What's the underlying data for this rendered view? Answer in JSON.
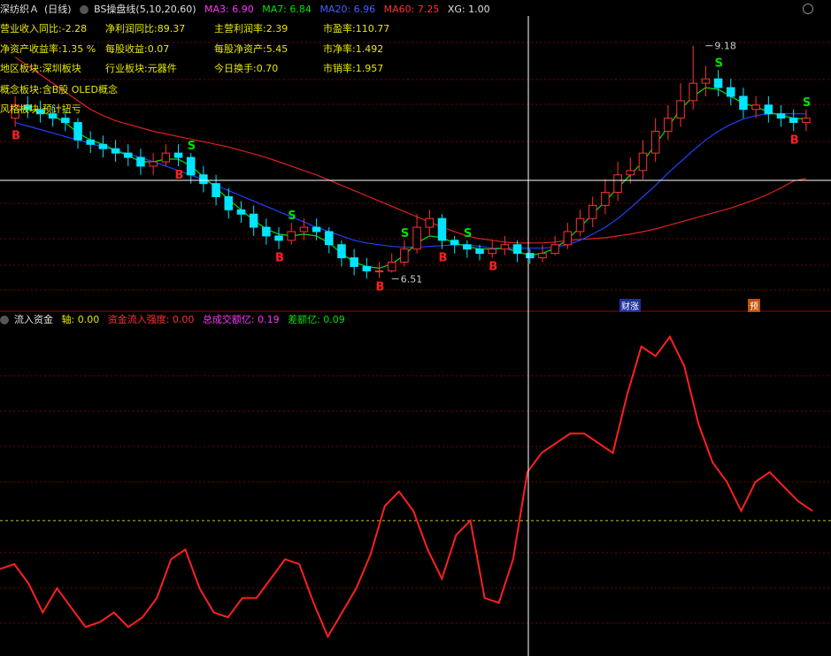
{
  "header": {
    "stock": "深纺织Ａ",
    "period": "(日线)",
    "indicator": "BS操盘线(5,10,20,60)",
    "ma3": "MA3: 6.90",
    "ma7": "MA7: 6.84",
    "ma20": "MA20: 6.96",
    "ma60": "MA60: 7.25",
    "xg": "XG: 1.00"
  },
  "info": {
    "r1": [
      {
        "label": "营业收入同比:",
        "value": "-2.28"
      },
      {
        "label": "净利润同比:",
        "value": "89.37"
      },
      {
        "label": "主营利润率:",
        "value": "2.39"
      },
      {
        "label": "市盈率:",
        "value": "110.77"
      }
    ],
    "r2": [
      {
        "label": "净资产收益率:",
        "value": "1.35 %"
      },
      {
        "label": "每股收益:",
        "value": "0.07"
      },
      {
        "label": "每股净资产:",
        "value": "5.45"
      },
      {
        "label": "市净率:",
        "value": "1.492"
      }
    ],
    "r3": [
      {
        "label": "地区板块:",
        "value": "深圳板块"
      },
      {
        "label": "行业板块:",
        "value": "元器件"
      },
      {
        "label": "今日换手:",
        "value": "0.70"
      },
      {
        "label": "市销率:",
        "value": "1.957"
      }
    ],
    "r4": {
      "label": "概念板块:",
      "value": "含B股 OLED概念"
    },
    "r5": {
      "label": "风格板块:",
      "value": "预计扭亏"
    }
  },
  "tags": {
    "left": "财涨",
    "right": "预"
  },
  "sub_header": {
    "name": "流入资金",
    "axis": "轴: 0.00",
    "strength": "资金流入强度: 0.00",
    "total": "总成交额亿: 0.19",
    "diff": "差额亿: 0.09"
  },
  "colors": {
    "up": "#ff3333",
    "down": "#00e5ff",
    "ma5": "#00e000",
    "ma20": "#2040ff",
    "ma60": "#e02020",
    "grid": "#7a0000",
    "crosshair": "#ffffff",
    "flow": "#ff2020",
    "zero": "#c8c800"
  },
  "chart_data": [
    {
      "type": "candlestick",
      "title": "",
      "ylim": [
        6.3,
        9.4
      ],
      "annotations": [
        {
          "text": "9.18",
          "x": 56,
          "y": 9.18
        },
        {
          "text": "6.51",
          "x": 31,
          "y": 6.51
        }
      ],
      "x": [
        1,
        2,
        3,
        4,
        5,
        6,
        7,
        8,
        9,
        10,
        11,
        12,
        13,
        14,
        15,
        16,
        17,
        18,
        19,
        20,
        21,
        22,
        23,
        24,
        25,
        26,
        27,
        28,
        29,
        30,
        31,
        32,
        33,
        34,
        35,
        36,
        37,
        38,
        39,
        40,
        41,
        42,
        43,
        44,
        45,
        46,
        47,
        48,
        49,
        50,
        51,
        52,
        53,
        54,
        55,
        56,
        57,
        58,
        59,
        60,
        61,
        62,
        63,
        64
      ],
      "open": [
        8.35,
        8.5,
        8.45,
        8.4,
        8.35,
        8.3,
        8.1,
        8.05,
        8.0,
        7.95,
        7.9,
        7.8,
        7.85,
        7.95,
        7.9,
        7.7,
        7.6,
        7.45,
        7.3,
        7.25,
        7.1,
        7.0,
        6.95,
        7.05,
        7.1,
        7.05,
        6.9,
        6.75,
        6.65,
        6.6,
        6.6,
        6.7,
        6.85,
        7.1,
        7.2,
        6.95,
        6.9,
        6.85,
        6.8,
        6.85,
        6.9,
        6.8,
        6.75,
        6.8,
        6.9,
        7.05,
        7.2,
        7.35,
        7.5,
        7.7,
        7.75,
        7.95,
        8.2,
        8.35,
        8.55,
        8.75,
        8.8,
        8.7,
        8.6,
        8.45,
        8.5,
        8.4,
        8.35,
        8.3
      ],
      "close": [
        8.5,
        8.45,
        8.4,
        8.35,
        8.3,
        8.1,
        8.05,
        8.0,
        7.95,
        7.9,
        7.8,
        7.85,
        7.95,
        7.9,
        7.7,
        7.6,
        7.45,
        7.3,
        7.25,
        7.1,
        7.0,
        6.95,
        7.05,
        7.1,
        7.05,
        6.9,
        6.75,
        6.65,
        6.6,
        6.6,
        6.7,
        6.85,
        7.1,
        7.2,
        6.95,
        6.9,
        6.85,
        6.8,
        6.85,
        6.9,
        6.8,
        6.75,
        6.8,
        6.9,
        7.05,
        7.2,
        7.35,
        7.5,
        7.7,
        7.75,
        7.95,
        8.2,
        8.35,
        8.55,
        8.75,
        8.8,
        8.7,
        8.6,
        8.45,
        8.5,
        8.4,
        8.35,
        8.3,
        8.35
      ],
      "high": [
        8.6,
        8.6,
        8.55,
        8.5,
        8.45,
        8.35,
        8.2,
        8.15,
        8.1,
        8.05,
        8.0,
        7.95,
        8.05,
        8.05,
        7.95,
        7.8,
        7.7,
        7.55,
        7.4,
        7.35,
        7.2,
        7.1,
        7.15,
        7.2,
        7.2,
        7.1,
        6.95,
        6.85,
        6.75,
        6.7,
        6.8,
        6.95,
        7.25,
        7.3,
        7.25,
        7.0,
        6.95,
        6.9,
        6.95,
        7.0,
        6.95,
        6.85,
        6.9,
        7.0,
        7.15,
        7.3,
        7.45,
        7.65,
        7.85,
        7.9,
        8.1,
        8.35,
        8.5,
        8.75,
        9.18,
        8.95,
        8.9,
        8.8,
        8.7,
        8.6,
        8.6,
        8.5,
        8.45,
        8.45
      ],
      "low": [
        8.25,
        8.35,
        8.3,
        8.25,
        8.2,
        8.0,
        7.95,
        7.9,
        7.85,
        7.8,
        7.7,
        7.7,
        7.8,
        7.8,
        7.6,
        7.5,
        7.35,
        7.2,
        7.15,
        7.0,
        6.9,
        6.85,
        6.9,
        6.95,
        6.95,
        6.8,
        6.65,
        6.55,
        6.51,
        6.52,
        6.58,
        6.65,
        6.8,
        7.0,
        6.85,
        6.8,
        6.75,
        6.72,
        6.75,
        6.78,
        6.7,
        6.68,
        6.7,
        6.78,
        6.85,
        7.0,
        7.1,
        7.25,
        7.4,
        7.6,
        7.65,
        7.85,
        8.1,
        8.25,
        8.45,
        8.6,
        8.6,
        8.5,
        8.35,
        8.35,
        8.3,
        8.25,
        8.2,
        8.2
      ],
      "ma5": [
        8.45,
        8.45,
        8.42,
        8.38,
        8.3,
        8.18,
        8.1,
        8.05,
        7.98,
        7.92,
        7.85,
        7.85,
        7.88,
        7.88,
        7.8,
        7.68,
        7.55,
        7.42,
        7.3,
        7.18,
        7.08,
        7.02,
        7.0,
        7.02,
        7.0,
        6.92,
        6.8,
        6.7,
        6.65,
        6.63,
        6.68,
        6.78,
        6.92,
        7.0,
        6.98,
        6.92,
        6.88,
        6.85,
        6.85,
        6.86,
        6.82,
        6.78,
        6.8,
        6.86,
        6.96,
        7.1,
        7.25,
        7.4,
        7.55,
        7.7,
        7.85,
        8.05,
        8.25,
        8.45,
        8.6,
        8.7,
        8.68,
        8.6,
        8.52,
        8.48,
        8.42,
        8.38,
        8.35,
        8.34
      ],
      "ma20": [
        8.3,
        8.26,
        8.22,
        8.18,
        8.14,
        8.1,
        8.06,
        8.02,
        7.98,
        7.94,
        7.9,
        7.85,
        7.8,
        7.75,
        7.7,
        7.64,
        7.58,
        7.52,
        7.46,
        7.4,
        7.34,
        7.28,
        7.22,
        7.16,
        7.1,
        7.05,
        7.0,
        6.95,
        6.92,
        6.9,
        6.88,
        6.87,
        6.87,
        6.88,
        6.89,
        6.9,
        6.9,
        6.88,
        6.86,
        6.86,
        6.86,
        6.86,
        6.86,
        6.87,
        6.9,
        6.95,
        7.02,
        7.1,
        7.2,
        7.32,
        7.45,
        7.58,
        7.72,
        7.85,
        7.98,
        8.1,
        8.2,
        8.28,
        8.34,
        8.38,
        8.4,
        8.4,
        8.4,
        8.4
      ],
      "ma60": [
        9.05,
        8.95,
        8.85,
        8.75,
        8.65,
        8.55,
        8.45,
        8.38,
        8.32,
        8.28,
        8.24,
        8.2,
        8.17,
        8.14,
        8.11,
        8.08,
        8.05,
        8.02,
        7.98,
        7.94,
        7.9,
        7.85,
        7.8,
        7.75,
        7.7,
        7.64,
        7.58,
        7.52,
        7.46,
        7.4,
        7.34,
        7.28,
        7.22,
        7.16,
        7.1,
        7.05,
        7.0,
        6.97,
        6.95,
        6.93,
        6.92,
        6.92,
        6.92,
        6.93,
        6.95,
        6.96,
        6.97,
        6.98,
        7.0,
        7.02,
        7.05,
        7.08,
        7.12,
        7.16,
        7.2,
        7.24,
        7.28,
        7.32,
        7.37,
        7.42,
        7.48,
        7.55,
        7.63,
        7.66
      ],
      "signals": [
        {
          "x": 1,
          "text": "B",
          "color": "#ff2020"
        },
        {
          "x": 14,
          "text": "B",
          "color": "#ff2020"
        },
        {
          "x": 15,
          "text": "S",
          "color": "#00e000"
        },
        {
          "x": 22,
          "text": "B",
          "color": "#ff2020"
        },
        {
          "x": 23,
          "text": "S",
          "color": "#00e000"
        },
        {
          "x": 30,
          "text": "B",
          "color": "#ff2020"
        },
        {
          "x": 32,
          "text": "S",
          "color": "#00e000"
        },
        {
          "x": 35,
          "text": "B",
          "color": "#ff2020"
        },
        {
          "x": 37,
          "text": "S",
          "color": "#00e000"
        },
        {
          "x": 39,
          "text": "B",
          "color": "#ff2020"
        },
        {
          "x": 57,
          "text": "S",
          "color": "#00e000"
        },
        {
          "x": 63,
          "text": "B",
          "color": "#ff2020"
        },
        {
          "x": 64,
          "text": "S",
          "color": "#00e000"
        }
      ]
    },
    {
      "type": "line",
      "title": "",
      "series": [
        {
          "values": [
            -1.0,
            -0.9,
            -1.3,
            -1.9,
            -1.4,
            -1.8,
            -2.2,
            -2.1,
            -1.9,
            -2.2,
            -2.0,
            -1.6,
            -0.8,
            -0.6,
            -1.4,
            -1.9,
            -2.0,
            -1.6,
            -1.6,
            -1.2,
            -0.8,
            -0.9,
            -1.7,
            -2.4,
            -1.9,
            -1.4,
            -0.7,
            0.3,
            0.6,
            0.2,
            -0.6,
            -1.2,
            -0.3,
            0.0,
            -1.6,
            -1.7,
            -0.8,
            1.0,
            1.4,
            1.6,
            1.8,
            1.8,
            1.6,
            1.4,
            2.6,
            3.6,
            3.4,
            3.8,
            3.2,
            2.0,
            1.2,
            0.8,
            0.2,
            0.8,
            1.0,
            0.7,
            0.4,
            0.2
          ]
        }
      ],
      "ylim": [
        -2.8,
        4.0
      ]
    }
  ]
}
